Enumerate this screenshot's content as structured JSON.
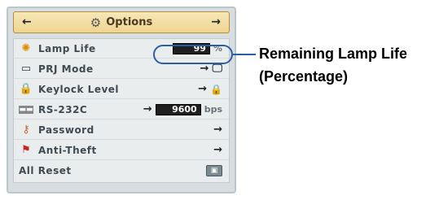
{
  "menu": {
    "title": "Options",
    "header_left_arrow": "←",
    "header_right_arrow": "→",
    "header_icon": "settings-icon",
    "rows": [
      {
        "label": "Lamp Life",
        "icon": "lamp-icon",
        "value": "99",
        "unit": "%"
      },
      {
        "label": "PRJ Mode",
        "icon": "projector-mode-icon",
        "arrow": "→"
      },
      {
        "label": "Keylock Level",
        "icon": "lock-icon",
        "arrow": "→"
      },
      {
        "label": "RS-232C",
        "icon": "rs232c-icon",
        "arrow": "→",
        "value": "9600",
        "unit": "bps"
      },
      {
        "label": "Password",
        "icon": "key-icon",
        "arrow": "→"
      },
      {
        "label": "Anti-Theft",
        "icon": "anti-theft-icon",
        "arrow": "→"
      },
      {
        "label": "All Reset",
        "icon": "",
        "button_icon": "reset-icon"
      }
    ]
  },
  "callout": {
    "line1": "Remaining Lamp Life",
    "line2": "(Percentage)"
  },
  "colors": {
    "highlight": "#2a5fa5",
    "header_bg": "#eed490",
    "menu_bg": "#d8dee0"
  }
}
